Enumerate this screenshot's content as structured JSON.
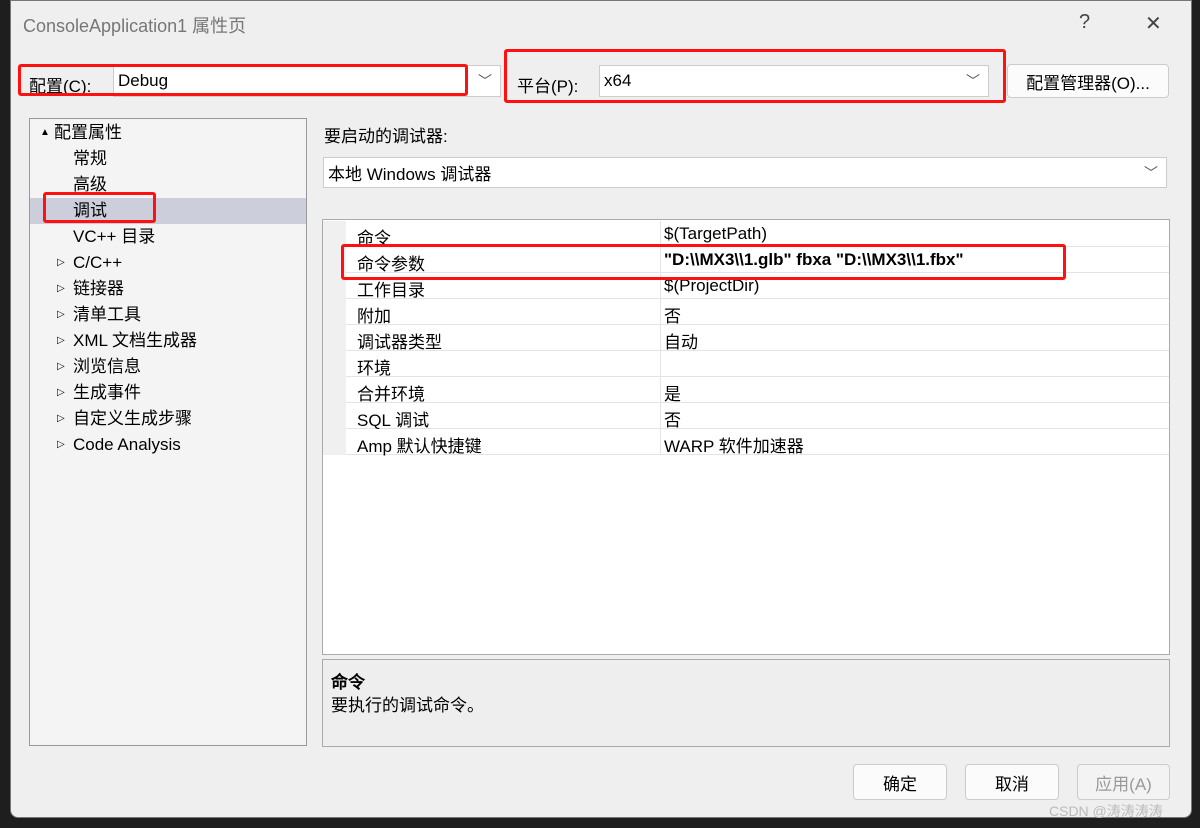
{
  "window": {
    "title": "ConsoleApplication1 属性页",
    "help": "?",
    "close": "✕"
  },
  "config": {
    "label": "配置(C):",
    "value": "Debug"
  },
  "platform": {
    "label": "平台(P):",
    "value": "x64"
  },
  "config_manager": "配置管理器(O)...",
  "tree": [
    {
      "label": "配置属性",
      "expander": "▲",
      "indent": 0
    },
    {
      "label": "常规",
      "expander": "",
      "indent": 1
    },
    {
      "label": "高级",
      "expander": "",
      "indent": 1
    },
    {
      "label": "调试",
      "expander": "",
      "indent": 1,
      "selected": true
    },
    {
      "label": "VC++ 目录",
      "expander": "",
      "indent": 1
    },
    {
      "label": "C/C++",
      "expander": "▷",
      "indent": 1
    },
    {
      "label": "链接器",
      "expander": "▷",
      "indent": 1
    },
    {
      "label": "清单工具",
      "expander": "▷",
      "indent": 1
    },
    {
      "label": "XML 文档生成器",
      "expander": "▷",
      "indent": 1
    },
    {
      "label": "浏览信息",
      "expander": "▷",
      "indent": 1
    },
    {
      "label": "生成事件",
      "expander": "▷",
      "indent": 1
    },
    {
      "label": "自定义生成步骤",
      "expander": "▷",
      "indent": 1
    },
    {
      "label": "Code Analysis",
      "expander": "▷",
      "indent": 1
    }
  ],
  "debugger": {
    "label": "要启动的调试器:",
    "value": "本地 Windows 调试器"
  },
  "properties": [
    {
      "name": "命令",
      "value": "$(TargetPath)"
    },
    {
      "name": "命令参数",
      "value": "\"D:\\\\MX3\\\\1.glb\" fbxa \"D:\\\\MX3\\\\1.fbx\"",
      "bold": true
    },
    {
      "name": "工作目录",
      "value": "$(ProjectDir)"
    },
    {
      "name": "附加",
      "value": "否"
    },
    {
      "name": "调试器类型",
      "value": "自动"
    },
    {
      "name": "环境",
      "value": ""
    },
    {
      "name": "合并环境",
      "value": "是"
    },
    {
      "name": "SQL 调试",
      "value": "否"
    },
    {
      "name": "Amp 默认快捷键",
      "value": "WARP 软件加速器"
    }
  ],
  "description": {
    "title": "命令",
    "text": "要执行的调试命令。"
  },
  "buttons": {
    "ok": "确定",
    "cancel": "取消",
    "apply": "应用(A)"
  },
  "watermark": "CSDN @涛涛涛涛",
  "colors": {
    "highlight": "#ff1111",
    "selected": "#cccedb"
  }
}
